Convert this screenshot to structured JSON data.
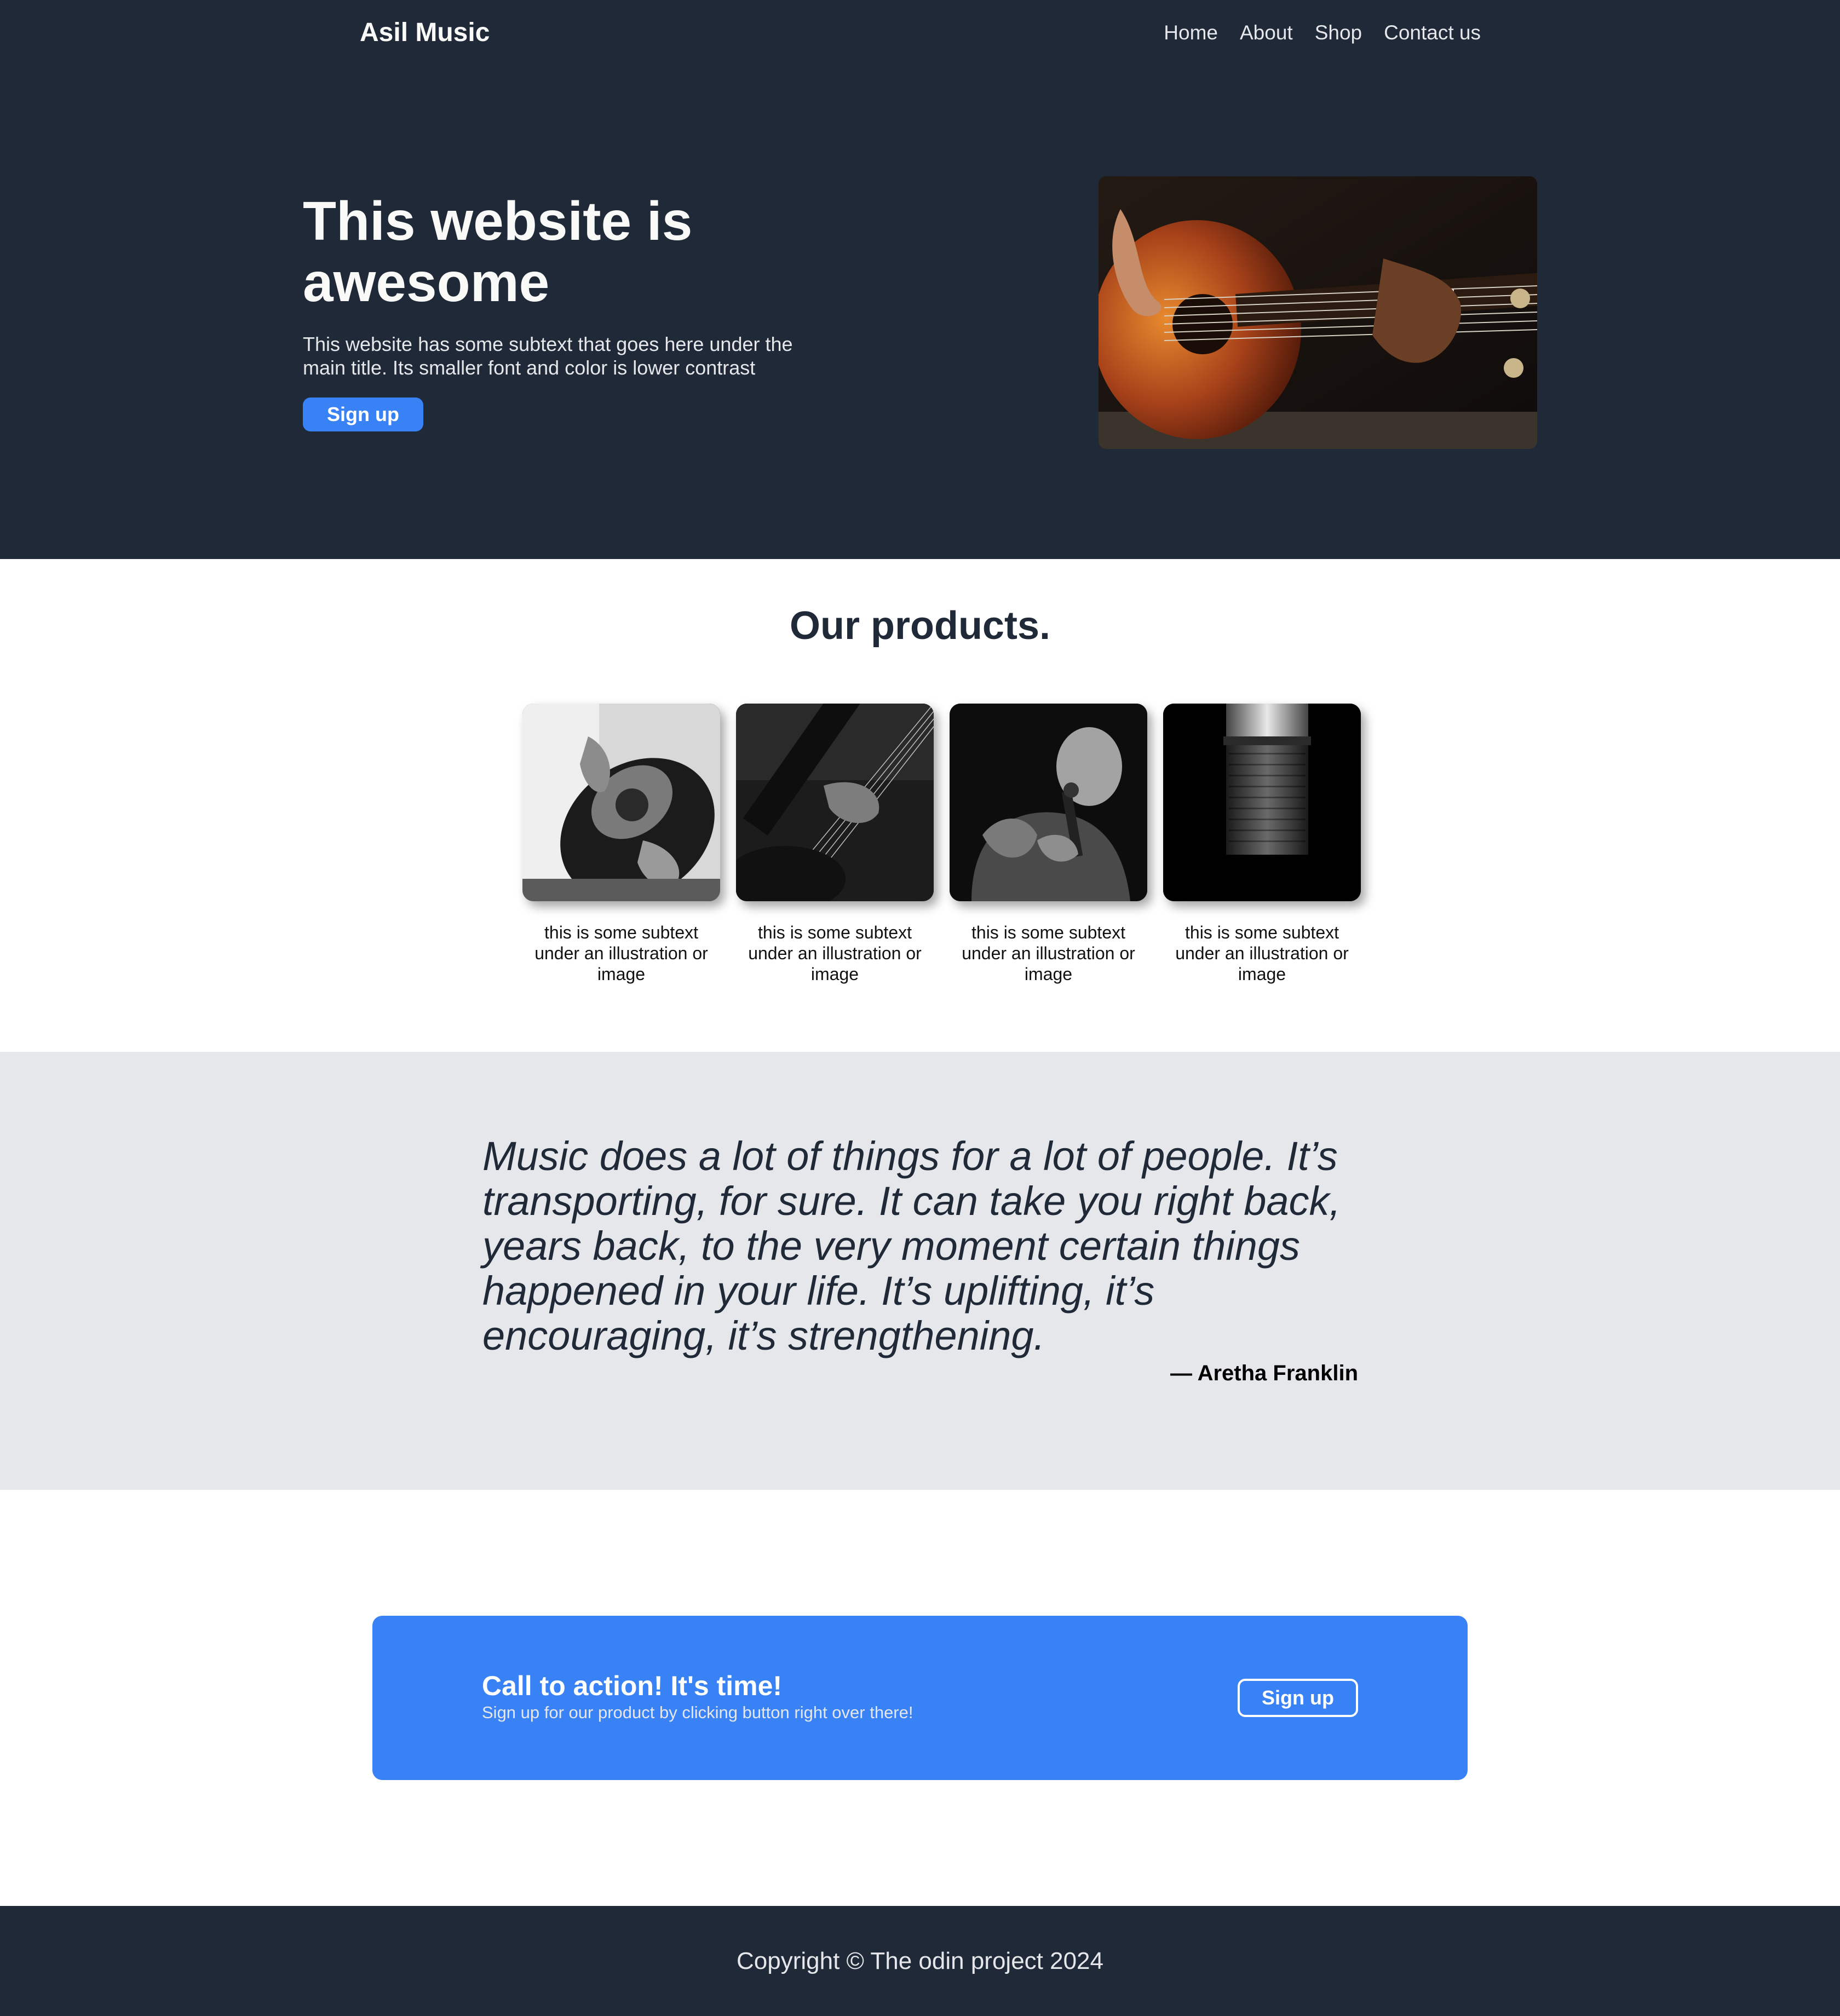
{
  "header": {
    "logo": "Asil Music",
    "nav": [
      "Home",
      "About",
      "Shop",
      "Contact us"
    ]
  },
  "hero": {
    "title": "This website is awesome",
    "subtext": "This website has some subtext that goes here under the main title. Its smaller font and color is lower contrast",
    "button_label": "Sign up",
    "image_icon": "guitar-photo"
  },
  "products": {
    "title": "Our products.",
    "items": [
      {
        "caption": "this is some subtext under an illustration or image",
        "image_icon": "acoustic-guitar-photo"
      },
      {
        "caption": "this is some subtext under an illustration or image",
        "image_icon": "electric-guitar-photo"
      },
      {
        "caption": "this is some subtext under an illustration or image",
        "image_icon": "singer-photo"
      },
      {
        "caption": "this is some subtext under an illustration or image",
        "image_icon": "microphone-photo"
      }
    ]
  },
  "quote": {
    "text": "Music does a lot of things for a lot of people. It’s transporting, for sure. It can take you right back, years back, to the very moment certain things happened in your life. It’s uplifting, it’s encouraging, it’s strengthening.",
    "author": "— Aretha Franklin"
  },
  "cta": {
    "title": "Call to action! It's time!",
    "subtext": "Sign up for our product by clicking button right over there!",
    "button_label": "Sign up"
  },
  "footer": {
    "copyright": "Copyright © The odin project 2024"
  },
  "colors": {
    "dark": "#1f2937",
    "accent": "#3882f6",
    "light_gray": "#e5e7eb",
    "white": "#f9faf8"
  }
}
